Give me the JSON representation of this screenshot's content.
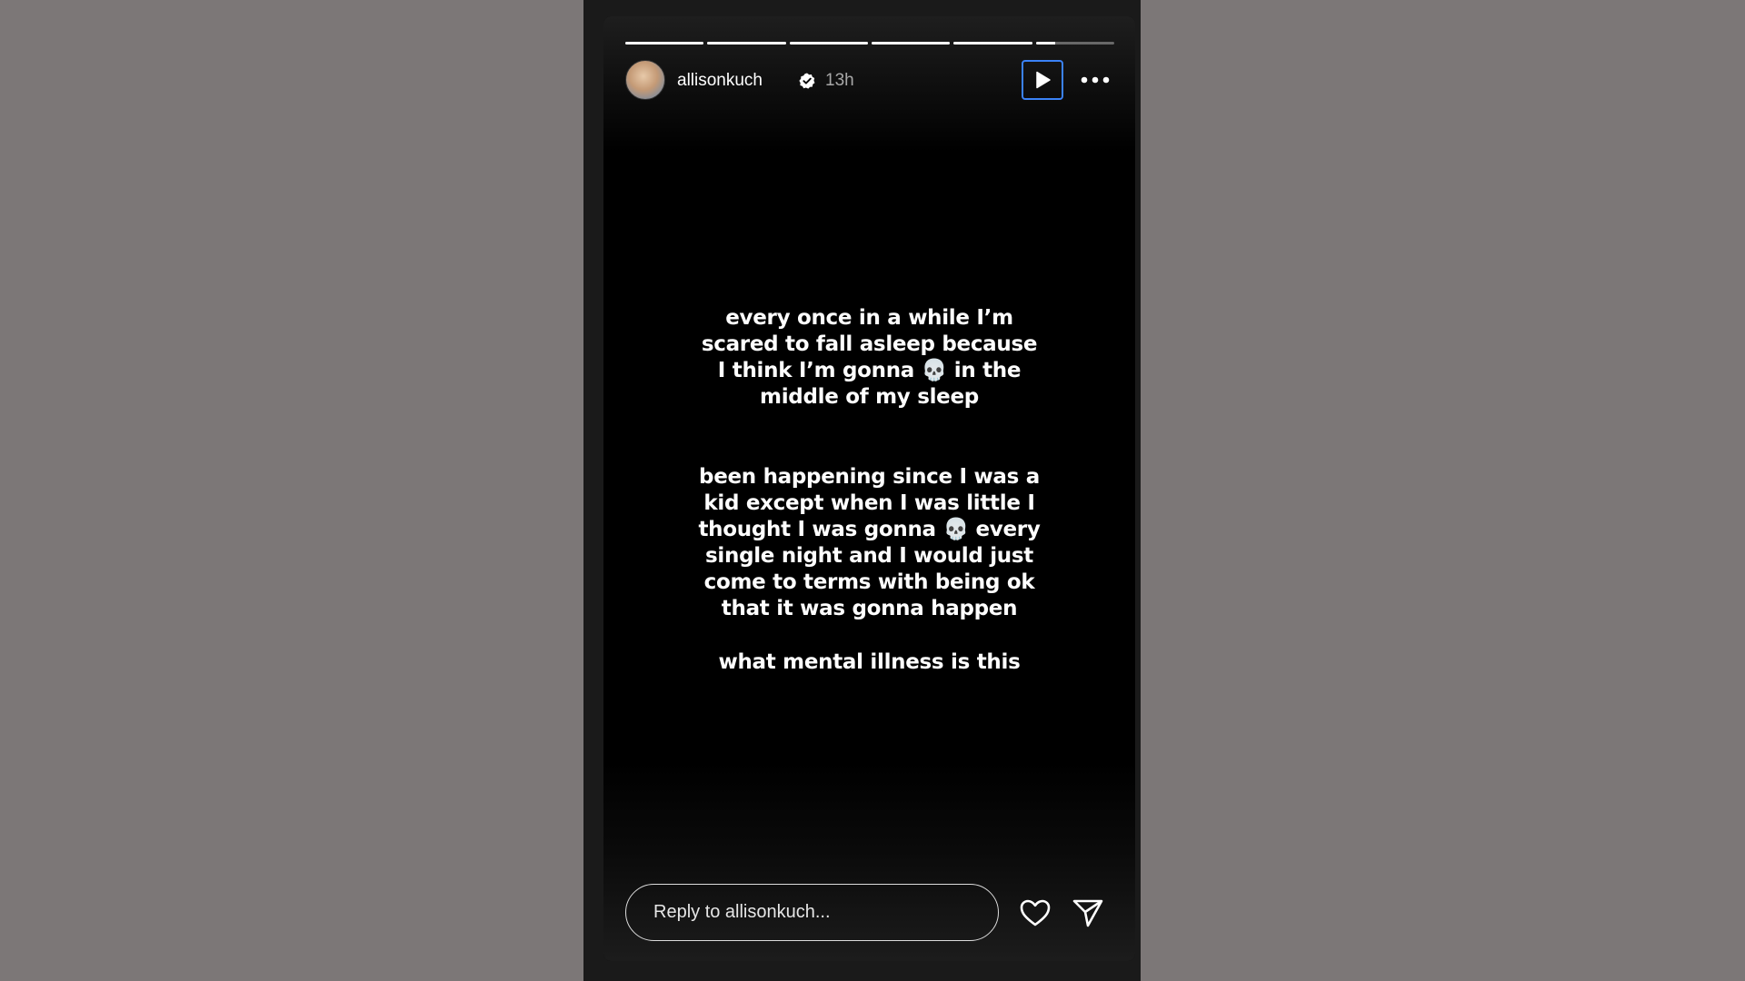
{
  "story": {
    "progress": {
      "segments": [
        1,
        1,
        1,
        1,
        1,
        0.25
      ]
    },
    "header": {
      "username": "allisonkuch",
      "timestamp": "13h",
      "verified": true
    },
    "text_blocks": [
      "every once in a while I’m\nscared to fall asleep because\nI think I’m gonna 💀 in the\nmiddle of my sleep",
      "been happening since I was a\nkid except when I was little I\nthought I was gonna 💀 every\nsingle night and I would just\ncome to terms with being ok\nthat it was gonna happen",
      "what mental illness is this"
    ],
    "reply": {
      "placeholder": "Reply to allisonkuch..."
    }
  },
  "colors": {
    "page_background": "#7c7777",
    "story_background": "#000000",
    "play_button_border": "#3b82f6",
    "text": "#ffffff",
    "timestamp": "#a8a8a8"
  },
  "icons": {
    "verified": "verified-badge-icon",
    "play": "play-icon",
    "more": "more-horizontal-icon",
    "like": "heart-icon",
    "share": "send-icon"
  }
}
